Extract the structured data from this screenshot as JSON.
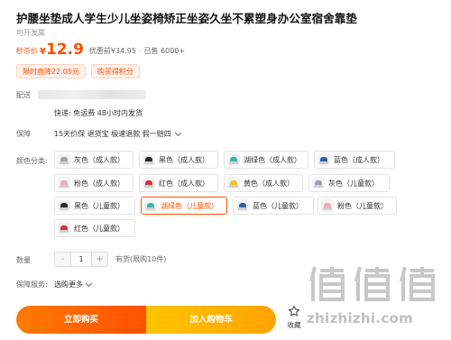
{
  "product": {
    "title": "护腰坐垫成人学生少儿坐姿椅矫正坐姿久坐不累塑身办公室宿舍靠垫",
    "invoice_note": "可开发票"
  },
  "price": {
    "label": "秒杀价",
    "currency": "¥",
    "value": "12.9",
    "original": "优惠前¥34.95",
    "separator": "·",
    "sold": "已售 6000+"
  },
  "coupons": [
    "限时直降22.05元",
    "购买得积分"
  ],
  "delivery": {
    "label": "配送",
    "shipping_text": "快递: 免运费  48小时内发货"
  },
  "guarantee": {
    "label": "保障",
    "text": "15天价保 退货宝 极速退款 假一赔四"
  },
  "colors": {
    "label": "颜色分类:",
    "options": [
      {
        "label": "灰色（成人款）",
        "accent": "#9aa3ad"
      },
      {
        "label": "黑色（成人款）",
        "accent": "#2b2b2b"
      },
      {
        "label": "湖绿色（成人款）",
        "accent": "#39b7b0"
      },
      {
        "label": "蓝色（成人款）",
        "accent": "#2e5fa8"
      },
      {
        "label": "粉色（成人款）",
        "accent": "#f2a9b8"
      },
      {
        "label": "红色（成人款）",
        "accent": "#d6313b"
      },
      {
        "label": "黄色（成人款）",
        "accent": "#f2c230"
      },
      {
        "label": "灰色（儿童款）",
        "accent": "#9aa3ad"
      },
      {
        "label": "黑色（儿童款）",
        "accent": "#2b2b2b"
      },
      {
        "label": "湖绿色（儿童款）",
        "accent": "#39b7b0"
      },
      {
        "label": "蓝色（儿童款）",
        "accent": "#2e5fa8"
      },
      {
        "label": "粉色（儿童款）",
        "accent": "#f2a9b8"
      },
      {
        "label": "红色（儿童款）",
        "accent": "#d6313b"
      }
    ],
    "selected_label": "湖绿色（儿童款）"
  },
  "quantity": {
    "label": "数量",
    "minus": "-",
    "value": "1",
    "plus": "+",
    "stock": "有货(限购10件)"
  },
  "service": {
    "label": "保障服务:",
    "value": "选购更多"
  },
  "actions": {
    "buy_now": "立即购买",
    "add_to_cart": "加入购物车",
    "favorite": "收藏"
  },
  "watermark": {
    "url": "zhizhizhi.com",
    "icon": "zhi-logo-watermark"
  },
  "theme": {
    "accent": "#ff5000",
    "cart": "#ffb300"
  }
}
